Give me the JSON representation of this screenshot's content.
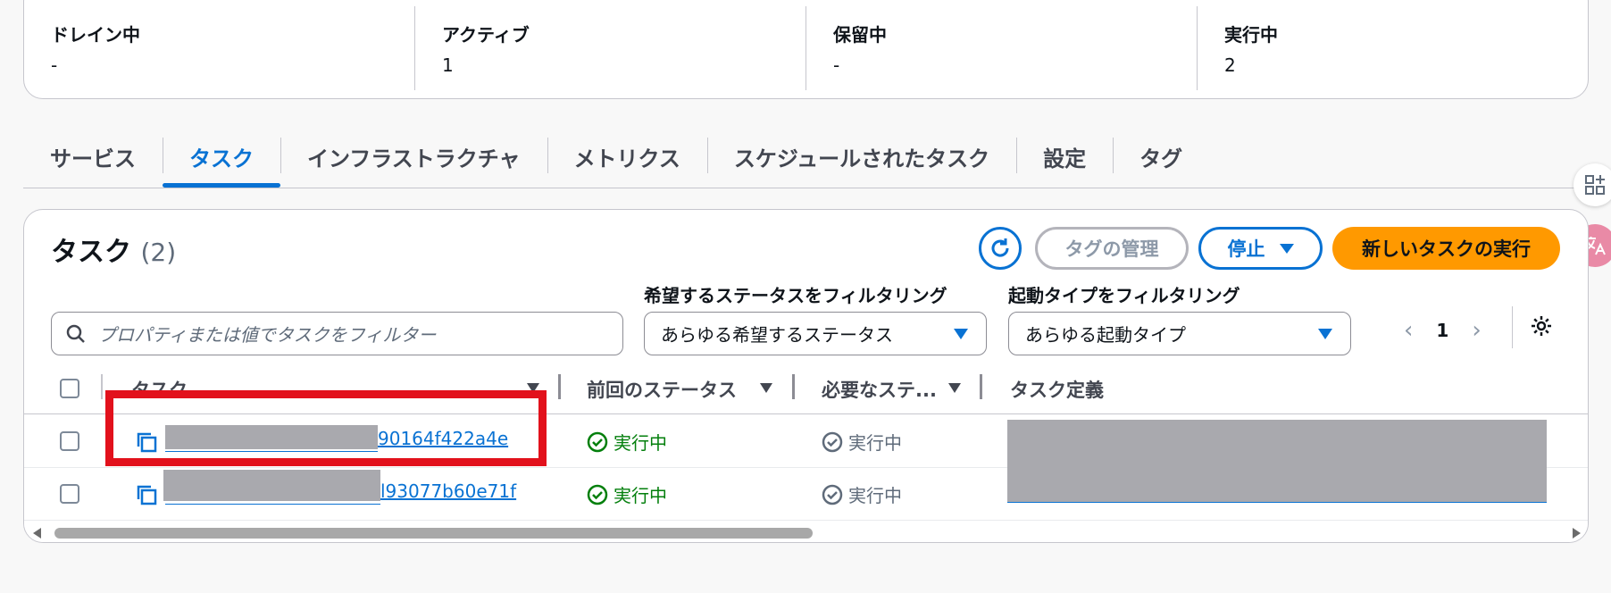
{
  "summary": [
    {
      "label": "ドレイン中",
      "value": "-"
    },
    {
      "label": "アクティブ",
      "value": "1"
    },
    {
      "label": "保留中",
      "value": "-"
    },
    {
      "label": "実行中",
      "value": "2"
    }
  ],
  "tabs": [
    {
      "label": "サービス"
    },
    {
      "label": "タスク"
    },
    {
      "label": "インフラストラクチャ"
    },
    {
      "label": "メトリクス"
    },
    {
      "label": "スケジュールされたタスク"
    },
    {
      "label": "設定"
    },
    {
      "label": "タグ"
    }
  ],
  "active_tab": "タスク",
  "panel": {
    "title": "タスク",
    "count": "(2)",
    "buttons": {
      "manage_tags": "タグの管理",
      "stop": "停止",
      "run_new_task": "新しいタスクの実行"
    },
    "filters": {
      "search_placeholder": "プロパティまたは値でタスクをフィルター",
      "desired_status_label": "希望するステータスをフィルタリング",
      "desired_status_value": "あらゆる希望するステータス",
      "launch_type_label": "起動タイプをフィルタリング",
      "launch_type_value": "あらゆる起動タイプ"
    },
    "pagination": {
      "page": "1"
    },
    "columns": {
      "task": "タスク",
      "last_status": "前回のステータス",
      "desired_status": "必要なステ...",
      "task_definition": "タスク定義"
    },
    "rows": [
      {
        "task_suffix": "90164f422a4e",
        "last_status": "実行中",
        "desired_status": "実行中"
      },
      {
        "task_suffix": "l93077b60e71f",
        "last_status": "実行中",
        "desired_status": "実行中"
      }
    ]
  },
  "colors": {
    "accent": "#0972d3",
    "primary_button": "#ff9900",
    "success": "#037f0c",
    "highlight": "#e2111c"
  }
}
